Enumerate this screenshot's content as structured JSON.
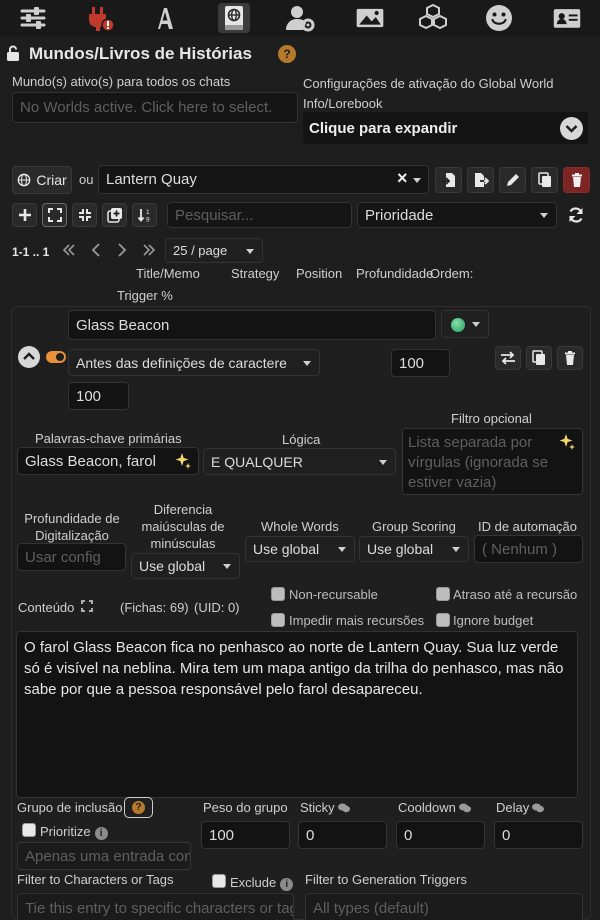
{
  "panel": {
    "title": "Mundos/Livros de Histórias",
    "help_glyph": "?"
  },
  "activation": {
    "active_worlds_label": "Mundo(s) ativo(s) para todos os chats",
    "active_worlds_placeholder": "No Worlds active. Click here to select.",
    "settings_label": "Configurações de ativação do Global World Info/Lorebook",
    "expand_label": "Clique para expandir"
  },
  "world_bar": {
    "create_label": "Criar",
    "or_label": "ou",
    "selected_world": "Lantern Quay",
    "clear_glyph": "×"
  },
  "tools": {
    "search_placeholder": "Pesquisar...",
    "sort_value": "Prioridade"
  },
  "pagination": {
    "range": "1-1 .. 1",
    "per_page": "25 / page"
  },
  "columns": {
    "title_memo": "Title/Memo",
    "strategy": "Strategy",
    "position": "Position",
    "depth": "Profundidade",
    "order": "Ordem:",
    "trigger": "Trigger %"
  },
  "entry": {
    "title": "Glass Beacon",
    "position_value": "Antes das definições de caractere",
    "order_value": "100",
    "trigger_value": "100",
    "primary_keywords_label": "Palavras-chave primárias",
    "primary_keywords_value": "Glass Beacon, farol",
    "logic_label": "Lógica",
    "logic_value": "E QUALQUER",
    "optional_filter_label": "Filtro opcional",
    "optional_filter_placeholder": "Lista separada por vírgulas (ignorada se estiver vazia)",
    "scan_depth_label": "Profundidade de Digitalização",
    "scan_depth_placeholder": "Usar config",
    "case_sensitive_label": "Diferencia maiúsculas de minúsculas",
    "case_sensitive_value": "Use global",
    "whole_words_label": "Whole Words",
    "whole_words_value": "Use global",
    "group_scoring_label": "Group Scoring",
    "group_scoring_value": "Use global",
    "automation_id_label": "ID de automação",
    "automation_id_placeholder": "( Nenhum )",
    "content_label": "Conteúdo",
    "tokens_text": "(Fichas:  69)",
    "uid_text": "(UID: 0)",
    "non_recursable_label": "Non-recursable",
    "delay_recursion_label": "Atraso até a recursão",
    "prevent_recursion_label": "Impedir mais recursões",
    "ignore_budget_label": "Ignore budget",
    "content_text": "O farol Glass Beacon fica no penhasco ao norte de Lantern Quay. Sua luz verde só é visível na neblina. Mira tem um mapa antigo da trilha do penhasco, mas não sabe por que a pessoa responsável pelo farol desapareceu.",
    "inclusion_group_label": "Grupo de inclusão",
    "prioritize_label": "Prioritize",
    "inclusion_group_placeholder": "Apenas uma entrada com o mesmo rótulo será ativada",
    "group_weight_label": "Peso do grupo",
    "group_weight_value": "100",
    "sticky_label": "Sticky",
    "sticky_value": "0",
    "cooldown_label": "Cooldown",
    "cooldown_value": "0",
    "delay_label": "Delay",
    "delay_value": "0",
    "filter_chars_label": "Filter to Characters or Tags",
    "exclude_label": "Exclude",
    "filter_gen_label": "Filter to Generation Triggers",
    "filter_chars_placeholder": "Tie this entry to specific characters or tags",
    "filter_gen_placeholder": "All types (default)",
    "info_glyph": "i"
  },
  "colors": {
    "accent_orange": "#e8903a",
    "status_green": "#3cb371",
    "delete_red": "#8b2a2a",
    "help_badge": "#b57a2a"
  }
}
